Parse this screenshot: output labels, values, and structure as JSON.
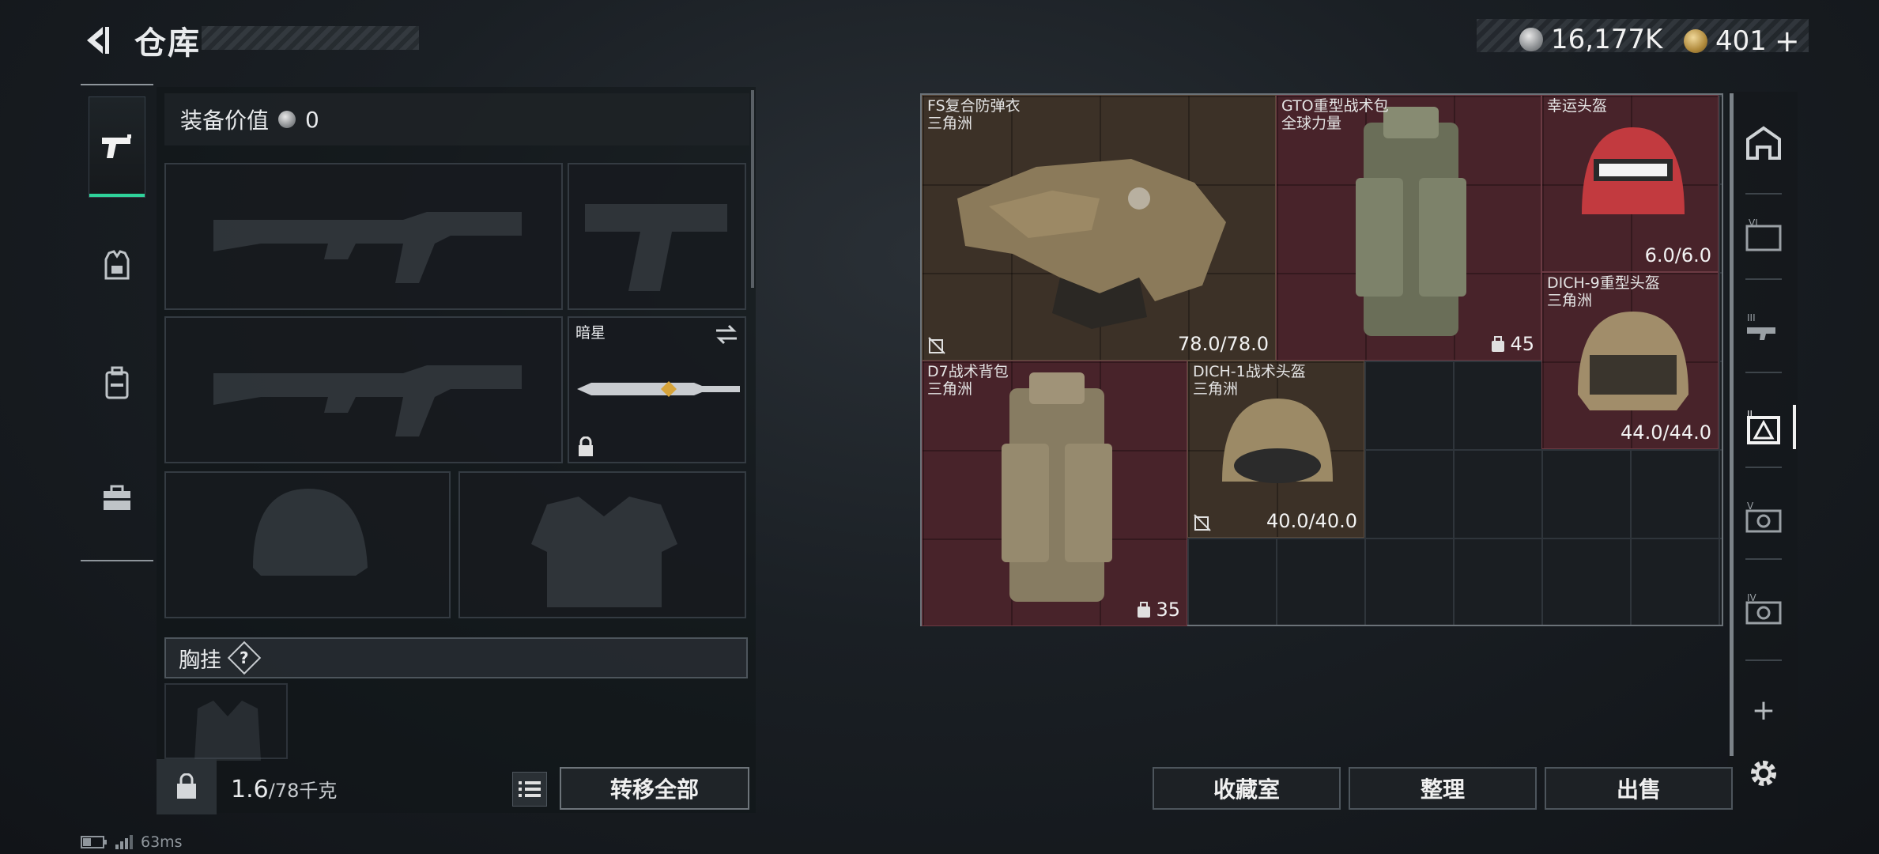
{
  "header": {
    "title": "仓库",
    "back_label": "back"
  },
  "currency": {
    "silver": "16,177K",
    "gold": "401",
    "gold_add": "+"
  },
  "loadout": {
    "value_label": "装备价值",
    "value": "0",
    "melee_name": "暗星",
    "chest_rig_label": "胸挂",
    "chest_rig_help": "?",
    "weight_current": "1.6",
    "weight_max": "/78千克",
    "transfer_all": "转移全部"
  },
  "stash": {
    "items": [
      {
        "name": "FS复合防弹衣",
        "sub": "三角洲",
        "value": "78.0/78.0",
        "rarity": "gold"
      },
      {
        "name": "GTO重型战术包",
        "sub": "全球力量",
        "capacity": "45",
        "rarity": "red"
      },
      {
        "name": "幸运头盔",
        "sub": "",
        "value": "6.0/6.0",
        "rarity": "red"
      },
      {
        "name": "DICH-9重型头盔",
        "sub": "三角洲",
        "value": "44.0/44.0",
        "rarity": "red"
      },
      {
        "name": "D7战术背包",
        "sub": "三角洲",
        "capacity": "35",
        "rarity": "red"
      },
      {
        "name": "DICH-1战术头盔",
        "sub": "三角洲",
        "value": "40.0/40.0",
        "rarity": "gold"
      }
    ]
  },
  "actions": {
    "collection": "收藏室",
    "organize": "整理",
    "sell": "出售"
  },
  "rail": {
    "tabs": [
      "VI",
      "III",
      "II",
      "V",
      "IV"
    ],
    "add": "+"
  },
  "status": {
    "ping": "63ms"
  },
  "colors": {
    "accent": "#2fd29a",
    "gold_item": "#3c3127",
    "red_item": "#48232a"
  }
}
